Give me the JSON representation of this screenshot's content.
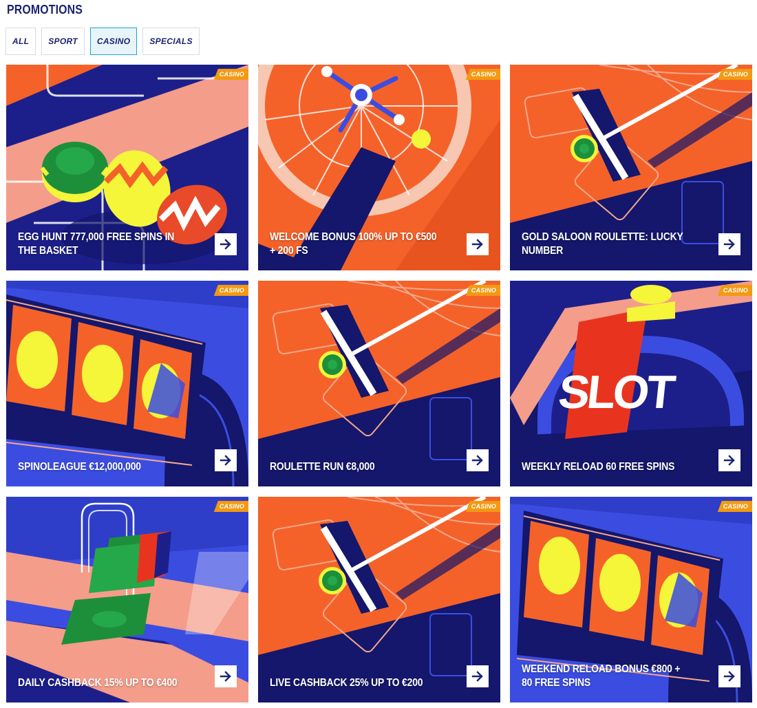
{
  "page": {
    "title": "PROMOTIONS"
  },
  "filters": [
    {
      "label": "ALL",
      "active": false
    },
    {
      "label": "SPORT",
      "active": false
    },
    {
      "label": "CASINO",
      "active": true
    },
    {
      "label": "SPECIALS",
      "active": false
    }
  ],
  "colors": {
    "navy": "#1b2372",
    "badge": "#f29a12",
    "active_filter_border": "#1aa5c8",
    "orange": "#f4622a",
    "deep_navy": "#14176b",
    "blue": "#3b4de0",
    "yellow": "#f5f53a",
    "green": "#1d8f3a",
    "salmon": "#f49d8a"
  },
  "promotions": [
    {
      "title": "EGG HUNT 777,000 FREE SPINS IN THE BASKET",
      "badge": "CASINO",
      "arrow_icon": "arrow-right-icon",
      "art": "easter-eggs-illustration"
    },
    {
      "title": "WELCOME BONUS 100% UP TO €500 + 200 FS",
      "badge": "CASINO",
      "arrow_icon": "arrow-right-icon",
      "art": "roulette-wheel-illustration"
    },
    {
      "title": "GOLD SALOON ROULETTE: LUCKY NUMBER",
      "badge": "CASINO",
      "arrow_icon": "arrow-right-icon",
      "art": "croupier-rake-illustration"
    },
    {
      "title": "SPINOLEAGUE €12,000,000",
      "badge": "CASINO",
      "arrow_icon": "arrow-right-icon",
      "art": "slot-reels-illustration"
    },
    {
      "title": "ROULETTE RUN €8,000",
      "badge": "CASINO",
      "arrow_icon": "arrow-right-icon",
      "art": "croupier-rake-illustration"
    },
    {
      "title": "WEEKLY RELOAD 60 FREE SPINS",
      "badge": "CASINO",
      "arrow_icon": "arrow-right-icon",
      "art": "slot-machine-illustration",
      "art_text": "SLOT"
    },
    {
      "title": "DAILY CASHBACK 15% UP TO €400",
      "badge": "CASINO",
      "arrow_icon": "arrow-right-icon",
      "art": "cash-arch-illustration"
    },
    {
      "title": "LIVE CASHBACK 25% UP TO €200",
      "badge": "CASINO",
      "arrow_icon": "arrow-right-icon",
      "art": "croupier-rake-illustration"
    },
    {
      "title": "WEEKEND RELOAD BONUS €800 + 80 FREE SPINS",
      "badge": "CASINO",
      "arrow_icon": "arrow-right-icon",
      "art": "slot-reels-illustration"
    }
  ]
}
